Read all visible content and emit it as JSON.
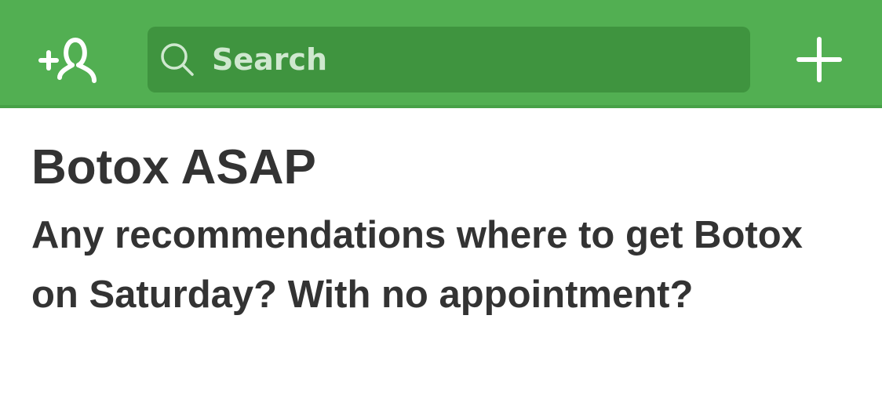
{
  "theme": {
    "header_bg": "#52af52",
    "search_bg": "#3f943f",
    "text_color": "#333333"
  },
  "header": {
    "add_neighbor_icon": "add-person-icon",
    "search": {
      "placeholder": "Search",
      "value": "",
      "icon": "magnifier-icon"
    },
    "compose_icon": "plus-icon"
  },
  "post": {
    "title": "Botox ASAP",
    "body": "Any recommendations where to get Botox on Saturday? With no appointment?"
  }
}
